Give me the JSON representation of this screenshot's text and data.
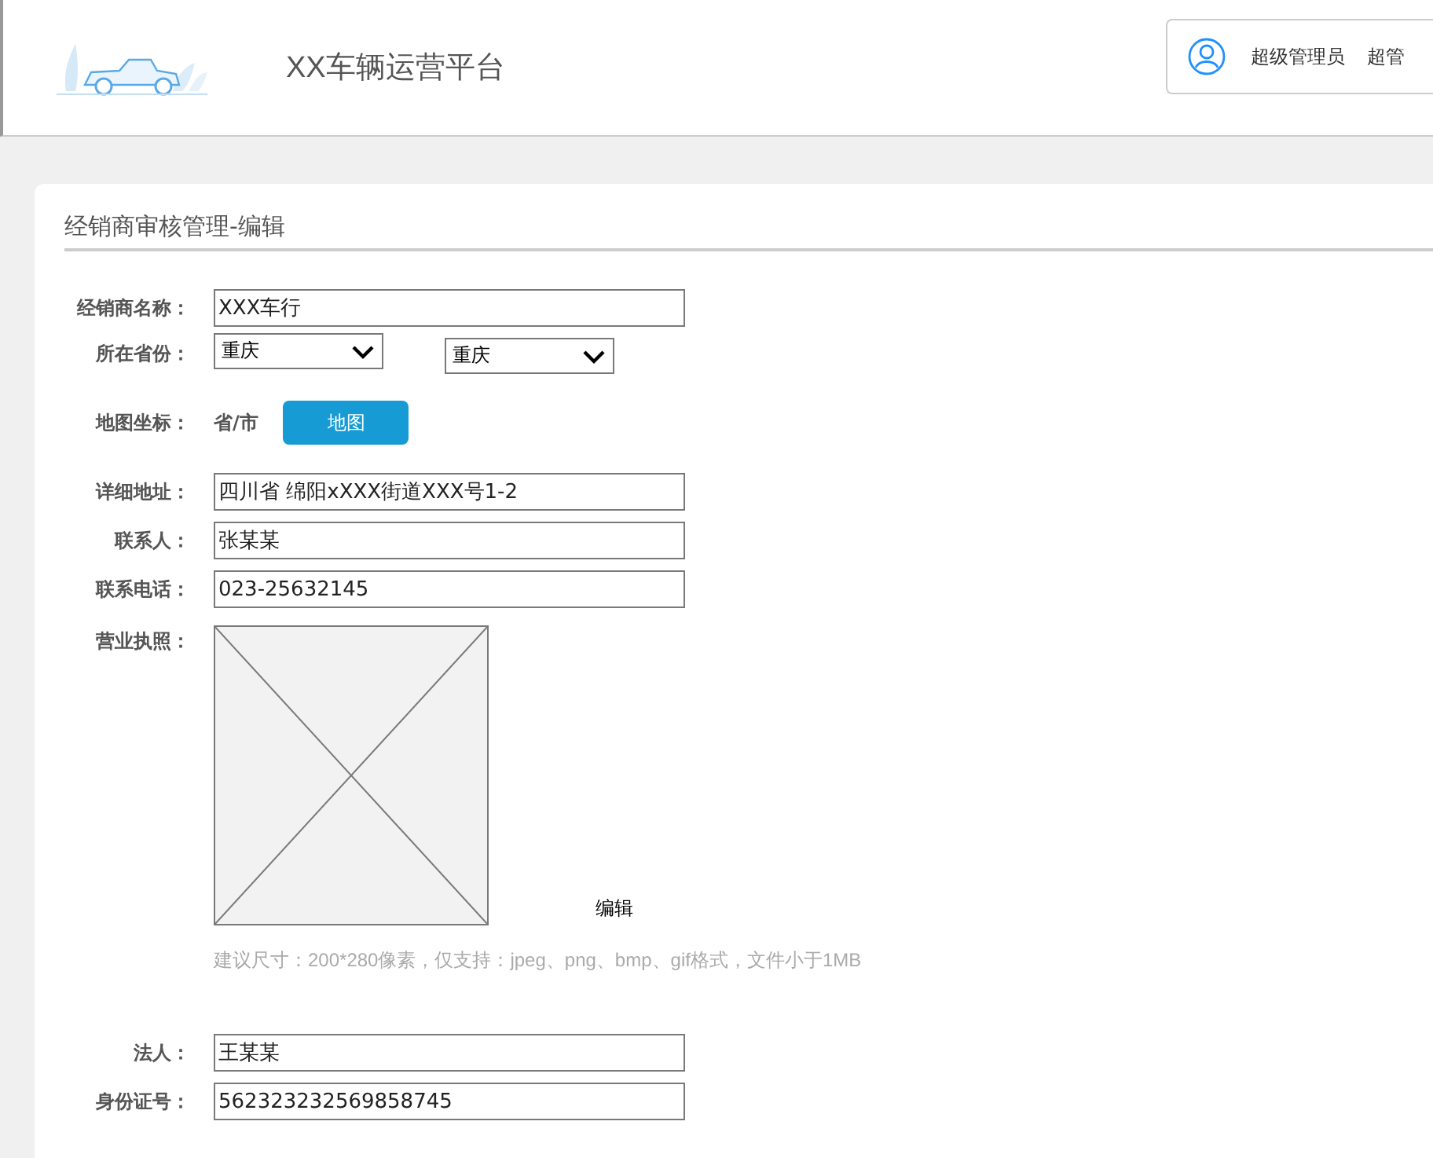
{
  "header": {
    "title": "XX车辆运营平台",
    "user_name": "超级管理员",
    "role": "超管"
  },
  "page_title": "经销商审核管理-编辑",
  "fields": [
    {
      "kind": "text",
      "label": "经销商名称：",
      "value": "XXX车行"
    },
    {
      "kind": "select",
      "label": "所在省份：",
      "options": [
        "重庆",
        "重庆"
      ]
    },
    {
      "kind": "map",
      "label": "地图坐标：",
      "text": "省/市",
      "button": "地图"
    },
    {
      "kind": "text",
      "label": "详细地址：",
      "value": "四川省 绵阳xXXX街道XXX号1-2"
    },
    {
      "kind": "text",
      "label": "联系人：",
      "value": "张某某"
    },
    {
      "kind": "text",
      "label": "联系电话：",
      "value": "023-25632145"
    },
    {
      "kind": "image",
      "label": "营业执照：",
      "action": "编辑",
      "hint": "建议尺寸：200*280像素，仅支持：jpeg、png、bmp、gif格式，文件小于1MB"
    },
    {
      "kind": "text",
      "label": "法人：",
      "value": "王某某"
    },
    {
      "kind": "text",
      "label": "身份证号：",
      "value": "562323232569858745"
    }
  ]
}
